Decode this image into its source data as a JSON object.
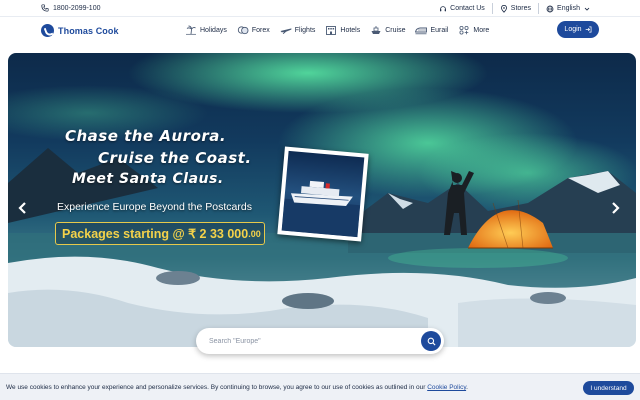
{
  "topbar": {
    "phone": "1800-2099-100",
    "contact": "Contact Us",
    "stores": "Stores",
    "language": "English"
  },
  "nav": {
    "logo": "Thomas Cook",
    "items": [
      {
        "label": "Holidays",
        "icon": "palm-tree-icon"
      },
      {
        "label": "Forex",
        "icon": "forex-icon"
      },
      {
        "label": "Flights",
        "icon": "plane-icon"
      },
      {
        "label": "Hotels",
        "icon": "hotel-icon"
      },
      {
        "label": "Cruise",
        "icon": "cruise-icon"
      },
      {
        "label": "Eurail",
        "icon": "train-icon"
      },
      {
        "label": "More",
        "icon": "more-icon"
      }
    ],
    "login": "Login"
  },
  "hero": {
    "line1": "Chase the Aurora.",
    "line2": "Cruise the Coast.",
    "line3": "Meet Santa Claus.",
    "subtitle": "Experience Europe Beyond the Postcards",
    "price_prefix": "Packages starting @ ₹ 2 33 000",
    "price_suffix": ".00"
  },
  "search": {
    "placeholder": "Search \"Europe\""
  },
  "cookie": {
    "text": "We use cookies to enhance your experience and personalize services. By continuing to browse, you agree to our use of cookies as outlined in our ",
    "link": "Cookie Policy",
    "end": ".",
    "button": "I understand"
  },
  "colors": {
    "brand": "#1e4a9c",
    "price": "#f4d24a"
  }
}
